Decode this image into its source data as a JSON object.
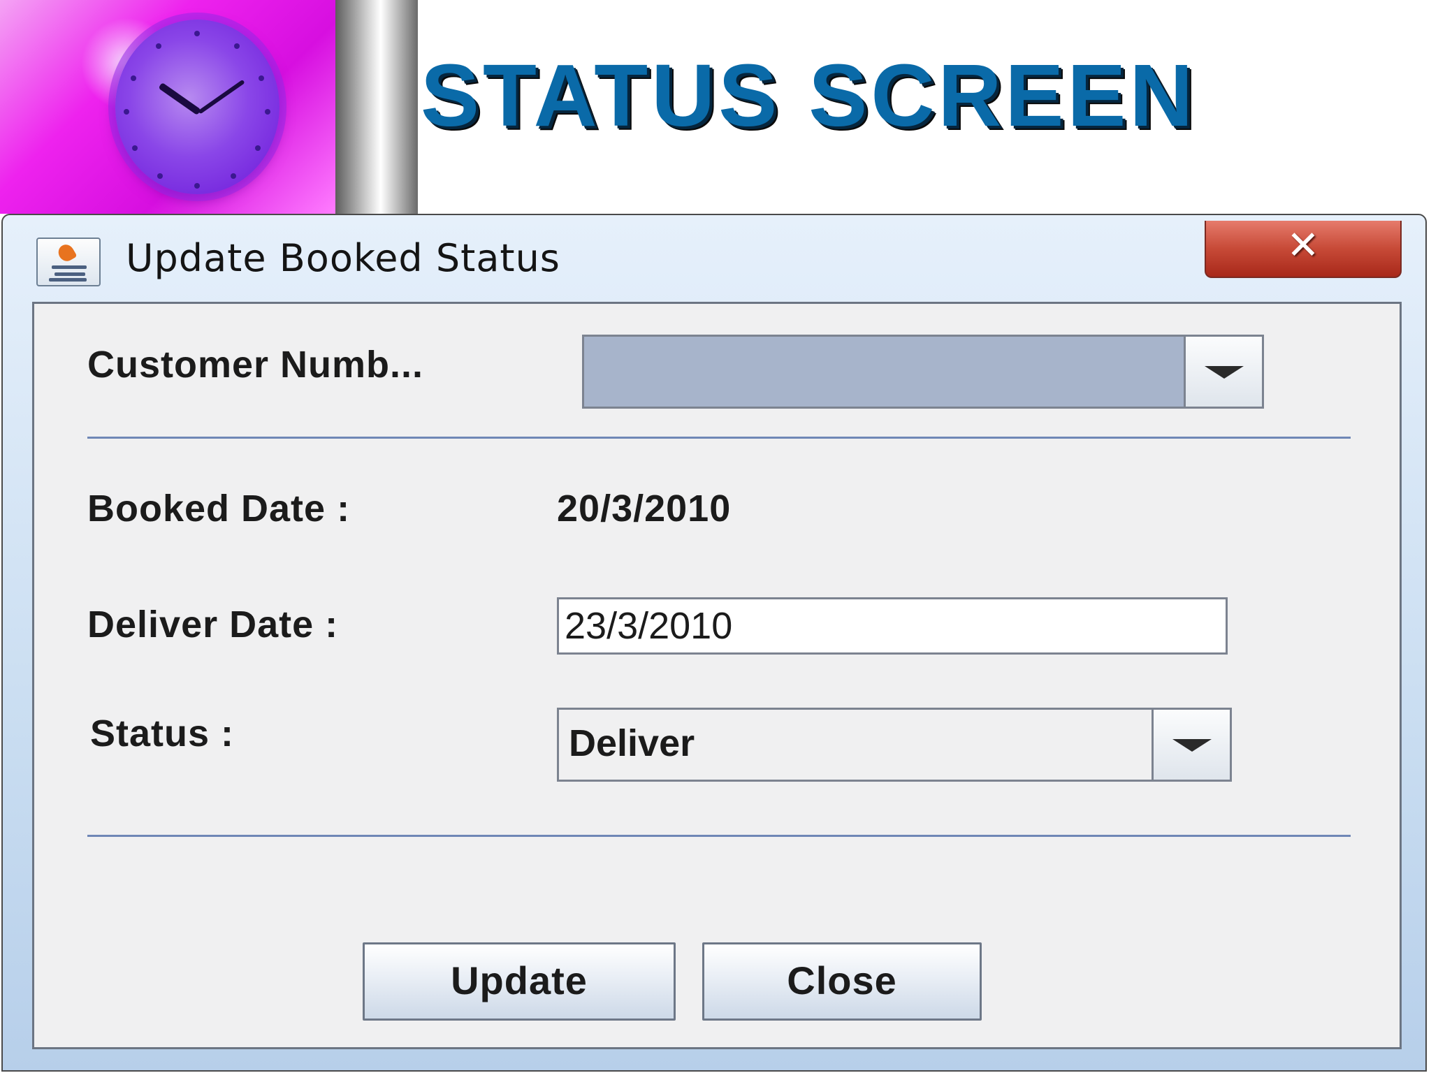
{
  "slide": {
    "title": "STATUS SCREEN"
  },
  "dialog": {
    "title": "Update Booked Status",
    "close_glyph": "✕"
  },
  "form": {
    "customer_number_label": "Customer Numb...",
    "customer_number_value": "",
    "booked_date_label": "Booked Date :",
    "booked_date_value": "20/3/2010",
    "deliver_date_label": "Deliver Date :",
    "deliver_date_value": "23/3/2010",
    "status_label": "Status :",
    "status_value": "Deliver"
  },
  "buttons": {
    "update_label": "Update",
    "close_label": "Close"
  },
  "icons": {
    "clock": "clock-picture",
    "app": "java-cup-icon",
    "close": "close-icon",
    "dropdown": "chevron-down-icon"
  },
  "colors": {
    "title": "#0a6aa8",
    "close_button": "#c74a37",
    "separator": "#6f87b6",
    "combo_empty": "#a7b4cb"
  }
}
